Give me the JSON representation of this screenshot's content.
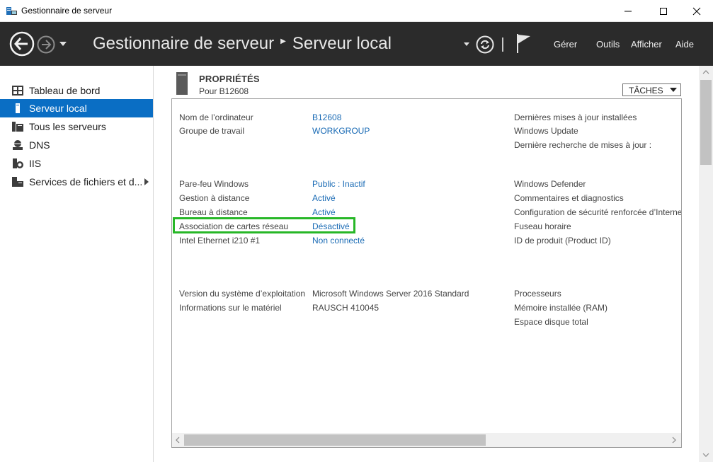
{
  "window": {
    "title": "Gestionnaire de serveur"
  },
  "header": {
    "app_name": "Gestionnaire de serveur",
    "page_name": "Serveur local",
    "menus": [
      "Gérer",
      "Outils",
      "Afficher",
      "Aide"
    ]
  },
  "sidebar": {
    "items": [
      {
        "label": "Tableau de bord",
        "icon": "dashboard-icon",
        "active": false
      },
      {
        "label": "Serveur local",
        "icon": "server-icon",
        "active": true
      },
      {
        "label": "Tous les serveurs",
        "icon": "servers-icon",
        "active": false
      },
      {
        "label": "DNS",
        "icon": "dns-icon",
        "active": false
      },
      {
        "label": "IIS",
        "icon": "iis-icon",
        "active": false
      },
      {
        "label": "Services de fichiers et d...",
        "icon": "file-services-icon",
        "active": false,
        "has_submenu": true
      }
    ]
  },
  "properties": {
    "title": "PROPRIÉTÉS",
    "subtitle": "Pour B12608",
    "tasks_label": "TÂCHES",
    "left_rows": [
      {
        "label": "Nom de l’ordinateur",
        "value": "B12608"
      },
      {
        "label": "Groupe de travail",
        "value": "WORKGROUP"
      },
      {
        "label": "Pare-feu Windows",
        "value": "Public : Inactif"
      },
      {
        "label": "Gestion à distance",
        "value": "Activé"
      },
      {
        "label": "Bureau à distance",
        "value": "Activé"
      },
      {
        "label": "Association de cartes réseau",
        "value": "Désactivé",
        "highlighted": true
      },
      {
        "label": "Intel Ethernet i210 #1",
        "value": "Non connecté"
      },
      {
        "label": "Version du système d’exploitation",
        "value": "Microsoft Windows Server 2016 Standard",
        "plain": true
      },
      {
        "label": "Informations sur le matériel",
        "value": "RAUSCH 410045",
        "plain": true
      }
    ],
    "right_labels": [
      "Dernières mises à jour installées",
      "Windows Update",
      "Dernière recherche de mises à jour :",
      "Windows Defender",
      "Commentaires et diagnostics",
      "Configuration de sécurité renforcée d’Interne",
      "Fuseau horaire",
      "ID de produit (Product ID)",
      "Processeurs",
      "Mémoire installée (RAM)",
      "Espace disque total"
    ]
  },
  "colors": {
    "header_bg": "#2b2b2b",
    "active_item": "#0a6ec4",
    "link": "#1a6bb5",
    "highlight": "#27b727"
  }
}
